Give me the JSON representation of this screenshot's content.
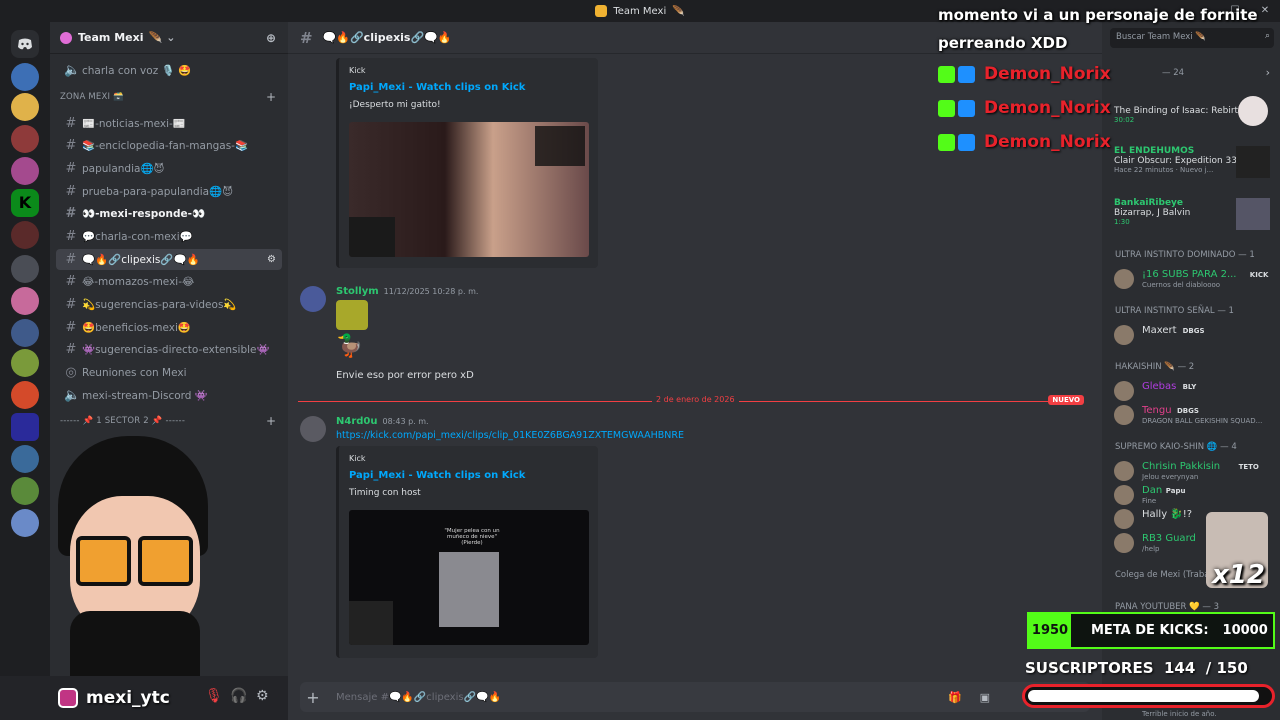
{
  "window": {
    "title": "Team Mexi"
  },
  "server": {
    "name": "Team Mexi"
  },
  "channels": [
    {
      "label": "charla con voz 🎙️ 🤩",
      "type": "voice"
    },
    {
      "label": "ZONA MEXI 🗃️",
      "type": "category"
    },
    {
      "label": "📰-noticias-mexi-📰",
      "type": "text"
    },
    {
      "label": "📚-enciclopedia-fan-mangas-📚",
      "type": "text"
    },
    {
      "label": "papulandia🌐😈",
      "type": "text"
    },
    {
      "label": "prueba-para-papulandia🌐😈",
      "type": "text"
    },
    {
      "label": "👀-mexi-responde-👀",
      "type": "text",
      "bold": true
    },
    {
      "label": "💬charla-con-mexi💬",
      "type": "text"
    },
    {
      "label": "🗨️🔥🔗clipexis🔗🗨️🔥",
      "type": "text",
      "active": true
    },
    {
      "label": "😂-momazos-mexi-😂",
      "type": "text"
    },
    {
      "label": "💫sugerencias-para-videos💫",
      "type": "text"
    },
    {
      "label": "🤩beneficios-mexi🤩",
      "type": "text"
    },
    {
      "label": "👾sugerencias-directo-extensible👾",
      "type": "text"
    },
    {
      "label": "Reuniones con Mexi",
      "type": "stage"
    },
    {
      "label": "mexi-stream-Discord 👾",
      "type": "voice"
    },
    {
      "label": "------ 📌 1 SECTOR 2 📌 ------",
      "type": "category"
    }
  ],
  "channel_header": {
    "name": "🗨️🔥🔗clipexis🔗🗨️🔥"
  },
  "messages": [
    {
      "embed": {
        "provider": "Kick",
        "title": "Papi_Mexi - Watch clips on Kick",
        "desc": "¡Desperto mi gatito!"
      }
    },
    {
      "author": "Stollym",
      "time": "11/12/2025 10:28 p. m.",
      "text": "Envie eso por error pero xD"
    },
    {
      "author": "N4rd0u",
      "time": "08:43 p. m.",
      "link": "https://kick.com/papi_mexi/clips/clip_01KE0Z6BGA91ZXTEMGWAAHBNRE",
      "embed": {
        "provider": "Kick",
        "title": "Papi_Mexi - Watch clips on Kick",
        "desc": "Timing con host",
        "thumb_text": "\"Mujer pelea con un muñeco de nieve\" (Pierde)"
      }
    }
  ],
  "divider": {
    "date": "2 de enero de 2026",
    "badge": "NUEVO"
  },
  "composer": {
    "placeholder": "Mensaje #🗨️🔥🔗clipexis🔗🗨️🔥"
  },
  "members": {
    "search_placeholder": "Buscar Team Mexi 🪶",
    "header_top": "— 24",
    "activities": [
      {
        "name": "",
        "activity": "The Binding of Isaac: Rebirth",
        "sub": "30:02"
      },
      {
        "name": "EL ENDEHUMOS",
        "activity": "Clair Obscur: Expedition 33",
        "sub": "Hace 22 minutos · Nuevo j..."
      },
      {
        "name": "BankaiRibeye",
        "activity": "Bizarrap, J Balvin",
        "sub": "1:30"
      }
    ],
    "groups": [
      {
        "title": "ULTRA INSTINTO DOMINADO — 1",
        "members": [
          {
            "name": "¡16 SUBS PARA 2...",
            "tag": "KICK",
            "status": "Cuernos del diabloooo"
          }
        ]
      },
      {
        "title": "ULTRA INSTINTO SEÑAL — 1",
        "members": [
          {
            "name": "Maxert",
            "tag": "DBGS",
            "status": ""
          }
        ]
      },
      {
        "title": "HAKAISHIN 🪶 — 2",
        "members": [
          {
            "name": "Glebas",
            "tag": "BLY",
            "status": ""
          },
          {
            "name": "Tengu",
            "tag": "DBGS",
            "status": "DRAGON BALL GEKISHIN SQUAD..."
          }
        ]
      },
      {
        "title": "SUPREMO KAIO-SHIN 🌐 — 4",
        "members": [
          {
            "name": "Chrisin Pakkisin",
            "tag": "TETO",
            "status": "Jelou everynyan"
          },
          {
            "name": "Dan",
            "tag": "Papu",
            "status": "Fine"
          },
          {
            "name": "Hally 🐉!?",
            "tag": "",
            "status": ""
          },
          {
            "name": "RB3 Guard",
            "tag": "",
            "status": "/help"
          }
        ]
      },
      {
        "title": "Colega de Mexi (Trabajo) 😂 — 1",
        "members": []
      },
      {
        "title": "PANA YOUTUBER 💛 — 3",
        "members": []
      }
    ],
    "bottom_status": "Terrible inicio de año."
  },
  "overlay": {
    "title_line1": "momento vi a un personaje de fornite",
    "title_line2": "perreando XDD",
    "raider": "Demon_Norix",
    "kick_goal": {
      "current": "1950",
      "label": "META DE KICKS:",
      "target": "10000"
    },
    "subs": {
      "label": "SUSCRIPTORES",
      "current": "144",
      "sep": "/",
      "target": "150",
      "progress": 0.96
    },
    "instagram": "mexi_ytc",
    "multiplier": "x12"
  },
  "colors": {
    "accent": "#5865f2",
    "kick_green": "#53fc18",
    "link": "#00a8fc",
    "danger": "#f23f43"
  }
}
